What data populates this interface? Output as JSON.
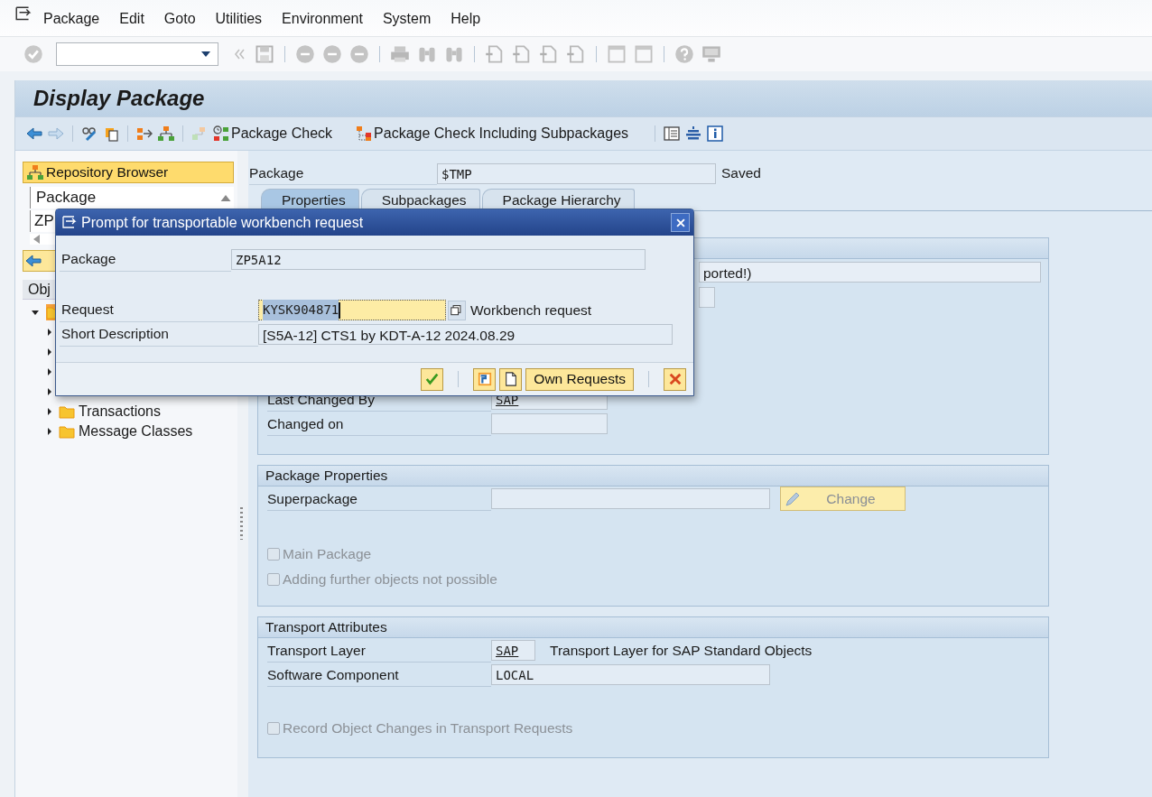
{
  "menu_bar": {
    "items": [
      "Package",
      "Edit",
      "Goto",
      "Utilities",
      "Environment",
      "System",
      "Help"
    ]
  },
  "title": "Display Package",
  "app_toolbar": {
    "buttons": [
      {
        "label": "Package Check"
      },
      {
        "label": "Package Check Including Subpackages"
      }
    ]
  },
  "navigator": {
    "browser_button": "Repository Browser",
    "object_list_type": "Package",
    "object_name": "ZP",
    "list_header": "Obj",
    "tree": [
      {
        "expanded": true,
        "children": [
          {
            "expanded": false
          },
          {
            "expanded": false
          },
          {
            "expanded": false
          },
          {
            "expanded": false
          },
          {
            "label": "Transactions",
            "expanded": false
          },
          {
            "label": "Message Classes",
            "expanded": false
          }
        ]
      }
    ]
  },
  "package_row": {
    "label": "Package",
    "value": "$TMP",
    "status": "Saved"
  },
  "tabs": [
    {
      "label": "Properties",
      "selected": true
    },
    {
      "label": "Subpackages",
      "selected": false
    },
    {
      "label": "Package Hierarchy",
      "selected": false
    }
  ],
  "overview": {
    "text_fragment": "ported!)",
    "rows": [
      {
        "label": "Last Changed By",
        "value": "SAP",
        "link": true
      },
      {
        "label": "Changed on"
      }
    ]
  },
  "package_properties": {
    "title": "Package Properties",
    "superpackage_label": "Superpackage",
    "change_button": "Change",
    "checkboxes": [
      {
        "label": "Main Package",
        "checked": false,
        "disabled": true
      },
      {
        "label": "Adding further objects not possible",
        "checked": false,
        "disabled": true
      }
    ]
  },
  "transport_attributes": {
    "title": "Transport Attributes",
    "rows": [
      {
        "label": "Transport Layer",
        "value": "SAP",
        "link": true,
        "description": "Transport Layer for SAP Standard Objects"
      },
      {
        "label": "Software Component",
        "value": "LOCAL",
        "link": false
      }
    ],
    "checkboxes": [
      {
        "label": "Record Object Changes in Transport Requests",
        "checked": false,
        "disabled": true
      }
    ]
  },
  "dialog": {
    "title": "Prompt for transportable workbench request",
    "package_label": "Package",
    "package_value": "ZP5A12",
    "request_label": "Request",
    "request_value": "KYSK904871",
    "request_type": "Workbench request",
    "description_label": "Short Description",
    "description_value": "[S5A-12] CTS1 by KDT-A-12 2024.08.29",
    "own_requests_button": "Own Requests"
  }
}
